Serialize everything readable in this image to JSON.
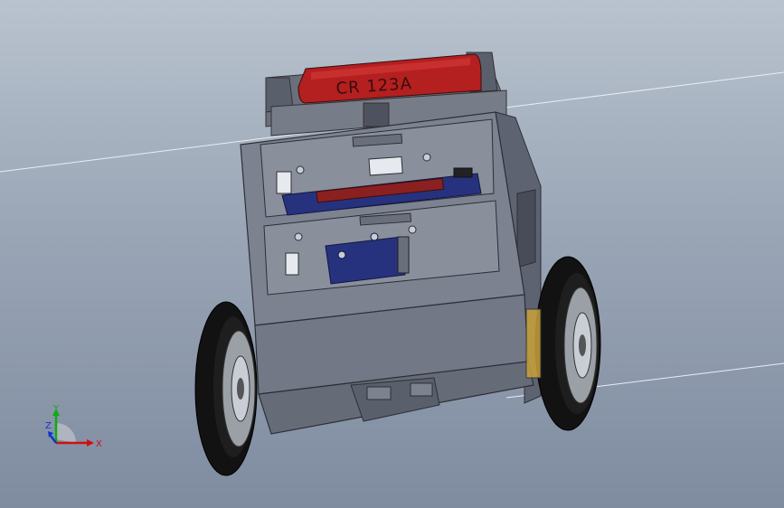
{
  "viewport": {
    "battery_label": "CR 123A",
    "colors": {
      "background_top": "#b9c3cf",
      "background_bottom": "#7f8ca0",
      "chassis": "#7d8290",
      "chassis_dark": "#5c6170",
      "battery": "#b41f1f",
      "pcb": "#27327e",
      "tire": "#121212",
      "rim": "#9aa0a6"
    }
  },
  "triad": {
    "x_label": "X",
    "y_label": "Y",
    "z_label": "Z",
    "x_color": "#cc1111",
    "y_color": "#11aa11",
    "z_color": "#1133cc"
  }
}
